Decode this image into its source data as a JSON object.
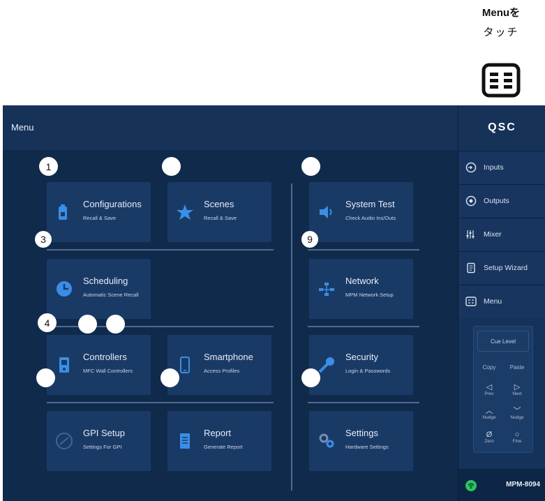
{
  "instruction": {
    "line1": "Menuを",
    "line2": "タッチ",
    "icon": "menu-icon"
  },
  "screen": {
    "title": "Menu"
  },
  "brand": {
    "logo": "QSC"
  },
  "tiles": {
    "configurations": {
      "name": "Configurations",
      "sub": "Recall & Save",
      "icon": "battery-icon"
    },
    "scenes": {
      "name": "Scenes",
      "sub": "Recall & Save",
      "icon": "star-icon"
    },
    "system_test": {
      "name": "System Test",
      "sub": "Check Audio Ins/Outs",
      "icon": "speaker-icon"
    },
    "scheduling": {
      "name": "Scheduling",
      "sub": "Automatic Scene Recall",
      "icon": "clock-icon"
    },
    "network": {
      "name": "Network",
      "sub": "MPM Network Setup",
      "icon": "network-icon"
    },
    "controllers": {
      "name": "Controllers",
      "sub": "MFC Wall Controllers",
      "icon": "wall-controller-icon"
    },
    "smartphone": {
      "name": "Smartphone",
      "sub": "Access Profiles",
      "icon": "smartphone-icon"
    },
    "security": {
      "name": "Security",
      "sub": "Login & Passwords",
      "icon": "key-icon"
    },
    "gpi_setup": {
      "name": "GPI Setup",
      "sub": "Settings For GPI",
      "icon": "gpi-icon"
    },
    "report": {
      "name": "Report",
      "sub": "Generate Report",
      "icon": "document-icon"
    },
    "settings": {
      "name": "Settings",
      "sub": "Hardware Settings",
      "icon": "gears-icon"
    }
  },
  "callouts": {
    "c1": "1",
    "c3": "3",
    "c4": "4",
    "c9": "9"
  },
  "sidebar": {
    "items": [
      {
        "label": "Inputs",
        "icon": "input-icon"
      },
      {
        "label": "Outputs",
        "icon": "output-icon"
      },
      {
        "label": "Mixer",
        "icon": "mixer-icon"
      },
      {
        "label": "Setup Wizard",
        "icon": "wizard-icon"
      },
      {
        "label": "Menu",
        "icon": "menu-icon"
      }
    ],
    "cue": {
      "level": "Cue Level",
      "copy": "Copy",
      "paste": "Paste",
      "prev": "Prev",
      "next": "Next",
      "nudge_up": "Nudge",
      "nudge_down": "Nudge",
      "zero": "Zero",
      "fine": "Fine"
    },
    "status": {
      "model": "MPM-8094",
      "icon": "wifi-icon"
    }
  },
  "colors": {
    "background": "#102a4c",
    "tile": "#1a3a66",
    "accent": "#3a8ee6",
    "status_green": "#2ec45a"
  }
}
